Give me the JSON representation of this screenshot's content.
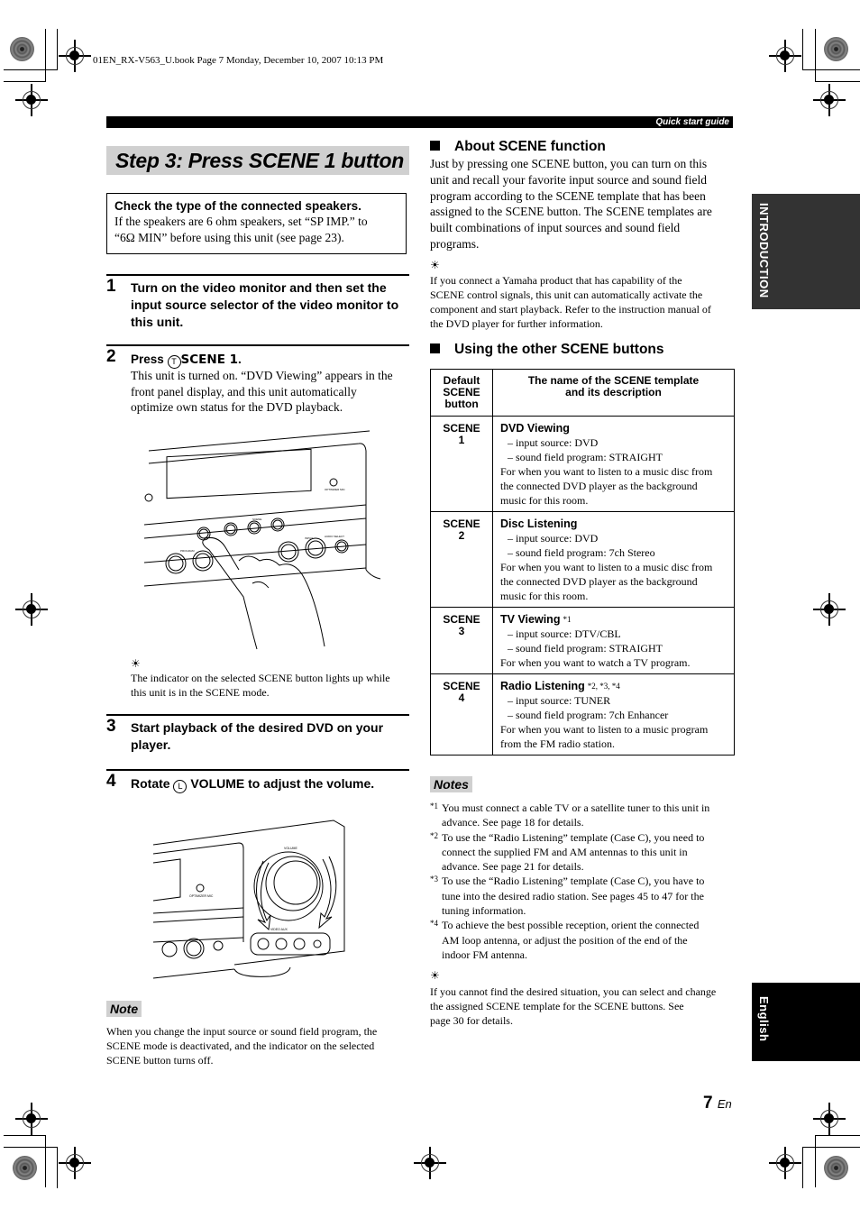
{
  "file_header": "01EN_RX-V563_U.book  Page 7  Monday, December 10, 2007  10:13 PM",
  "top_bar": {
    "label": "Quick start guide"
  },
  "title": "Step 3: Press SCENE 1 button",
  "check_box": {
    "title": "Check the type of the connected speakers.",
    "line1": "If the speakers are 6 ohm speakers, set “SP IMP.” to",
    "line2": "“6Ω MIN” before using this unit (see page 23)."
  },
  "steps": [
    {
      "num": "1",
      "text_lines": [
        "Turn on the video monitor and then set the",
        "input source selector of the video monitor to",
        "this unit."
      ]
    },
    {
      "num": "2",
      "press": "Press ",
      "key_symbol": "T",
      "key_label": "SCENE 1",
      "period": ".",
      "body_lines": [
        "This unit is turned on. “DVD Viewing” appears in the",
        "front panel display, and this unit automatically",
        "optimize own status for the DVD playback."
      ]
    },
    {
      "num": "3",
      "text_lines": [
        "Start playback of the desired DVD on your",
        "player."
      ]
    },
    {
      "num": "4",
      "pre": "Rotate ",
      "key_symbol": "L",
      "post": " VOLUME to adjust the volume."
    }
  ],
  "step2_tip": {
    "icon": "lightbulb-tip",
    "lines": [
      "The indicator on the selected SCENE button lights up while",
      "this unit is in the SCENE mode."
    ]
  },
  "illustrations": {
    "scene_press": "Hand pressing SCENE 1 button on receiver front panel",
    "volume": "Volume knob rotation on receiver front panel"
  },
  "note": {
    "label": "Note",
    "lines": [
      "When you change the input source or sound field program, the",
      "SCENE mode is deactivated, and the indicator on the selected",
      "SCENE button turns off."
    ]
  },
  "about": {
    "heading": "About SCENE function",
    "lines": [
      "Just by pressing one SCENE button, you can turn on this",
      "unit and recall your favorite input source and sound field",
      "program according to the SCENE template that has been",
      "assigned to the SCENE button. The SCENE templates are",
      "built combinations of input sources and sound field",
      "programs."
    ],
    "tip_lines": [
      "If you connect a Yamaha product that has capability of the",
      "SCENE control signals, this unit can automatically activate the",
      "component and start playback. Refer to the instruction manual of",
      "the DVD player for further information."
    ]
  },
  "using": {
    "heading": "Using the other SCENE buttons",
    "table": {
      "headers": [
        "Default SCENE button",
        "The name of the SCENE template and its description"
      ],
      "header_lines": [
        [
          "Default",
          "SCENE",
          "button"
        ],
        [
          "The name of the SCENE template",
          "and its description"
        ]
      ],
      "rows": [
        {
          "button": [
            "SCENE",
            "1"
          ],
          "name": "DVD Viewing",
          "sup": "",
          "input": "– input source: DVD",
          "program": "– sound field program: STRAIGHT",
          "desc_lines": [
            "For when you want to listen to a music disc from",
            "the connected DVD player as the background",
            "music for this room."
          ]
        },
        {
          "button": [
            "SCENE",
            "2"
          ],
          "name": "Disc Listening",
          "sup": "",
          "input": "– input source: DVD",
          "program": "– sound field program: 7ch Stereo",
          "desc_lines": [
            "For when you want to listen to a music disc from",
            "the connected DVD player as the background",
            "music for this room."
          ]
        },
        {
          "button": [
            "SCENE",
            "3"
          ],
          "name": "TV Viewing",
          "sup": "*1",
          "input": "– input source: DTV/CBL",
          "program": "– sound field program: STRAIGHT",
          "desc_lines": [
            "For when you want to watch a TV program."
          ]
        },
        {
          "button": [
            "SCENE",
            "4"
          ],
          "name": "Radio Listening",
          "sup": "*2, *3, *4",
          "input": "– input source: TUNER",
          "program": "– sound field program: 7ch Enhancer",
          "desc_lines": [
            "For when you want to listen to a music program",
            "from the FM radio station."
          ]
        }
      ]
    }
  },
  "notes": {
    "label": "Notes",
    "items": [
      {
        "mark": "*1",
        "lines": [
          "You must connect a cable TV or a satellite tuner to this unit in",
          "advance. See page 18 for details."
        ]
      },
      {
        "mark": "*2",
        "lines": [
          "To use the “Radio Listening” template (Case C), you need to",
          "connect the supplied FM and AM antennas to this unit in",
          "advance. See page 21 for details."
        ]
      },
      {
        "mark": "*3",
        "lines": [
          "To use the “Radio Listening” template (Case C), you have to",
          "tune into the desired radio station. See pages 45 to 47 for the",
          "tuning information."
        ]
      },
      {
        "mark": "*4",
        "lines": [
          "To achieve the best possible reception, orient the connected",
          "AM loop antenna, or adjust the position of the end of the",
          "indoor FM antenna."
        ]
      }
    ],
    "tip_lines": [
      "If you cannot find the desired situation, you can select and change",
      "the assigned SCENE template for the SCENE buttons. See",
      "page 30 for details."
    ]
  },
  "side_tabs": {
    "introduction": {
      "label": "INTRODUCTION",
      "color": "#333333"
    },
    "english": {
      "label": "English",
      "color": "#000000"
    }
  },
  "page": {
    "number": "7",
    "suffix": "En"
  },
  "tip_glyph": "☀"
}
